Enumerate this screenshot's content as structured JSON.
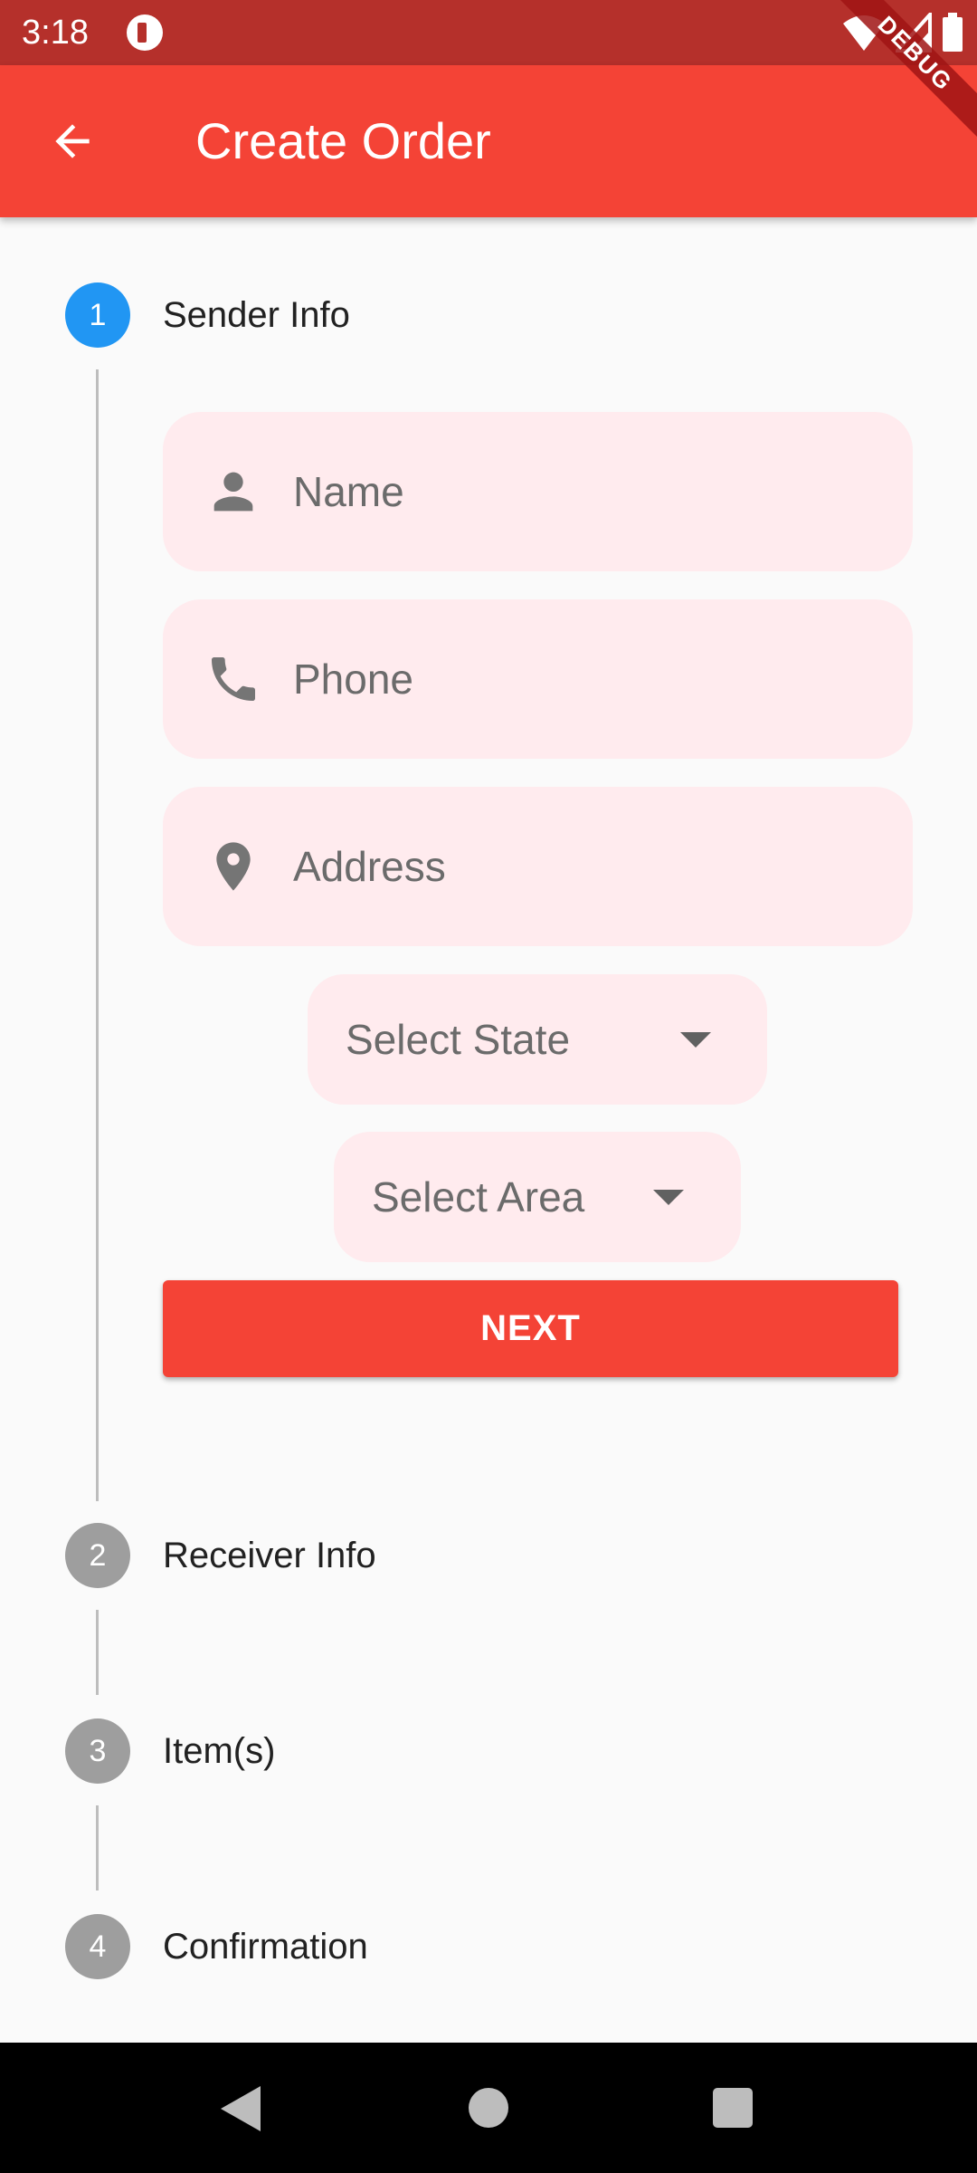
{
  "status_bar": {
    "time": "3:18"
  },
  "app_bar": {
    "title": "Create Order",
    "debug_badge": "DEBUG"
  },
  "colors": {
    "primary": "#F44336",
    "status_bar": "#B5302B",
    "active_step": "#2196F3",
    "inactive_step": "#9E9E9E",
    "field_background": "#FFEBEE"
  },
  "steps": [
    {
      "number": "1",
      "title": "Sender Info",
      "state": "active"
    },
    {
      "number": "2",
      "title": "Receiver Info",
      "state": "inactive"
    },
    {
      "number": "3",
      "title": "Item(s)",
      "state": "inactive"
    },
    {
      "number": "4",
      "title": "Confirmation",
      "state": "inactive"
    }
  ],
  "sender_form": {
    "name": {
      "placeholder": "Name",
      "icon": "person-icon"
    },
    "phone": {
      "placeholder": "Phone",
      "icon": "phone-icon"
    },
    "address": {
      "placeholder": "Address",
      "icon": "location-pin-icon"
    },
    "state_dropdown": {
      "label": "Select State"
    },
    "area_dropdown": {
      "label": "Select Area"
    },
    "next_label": "NEXT"
  }
}
